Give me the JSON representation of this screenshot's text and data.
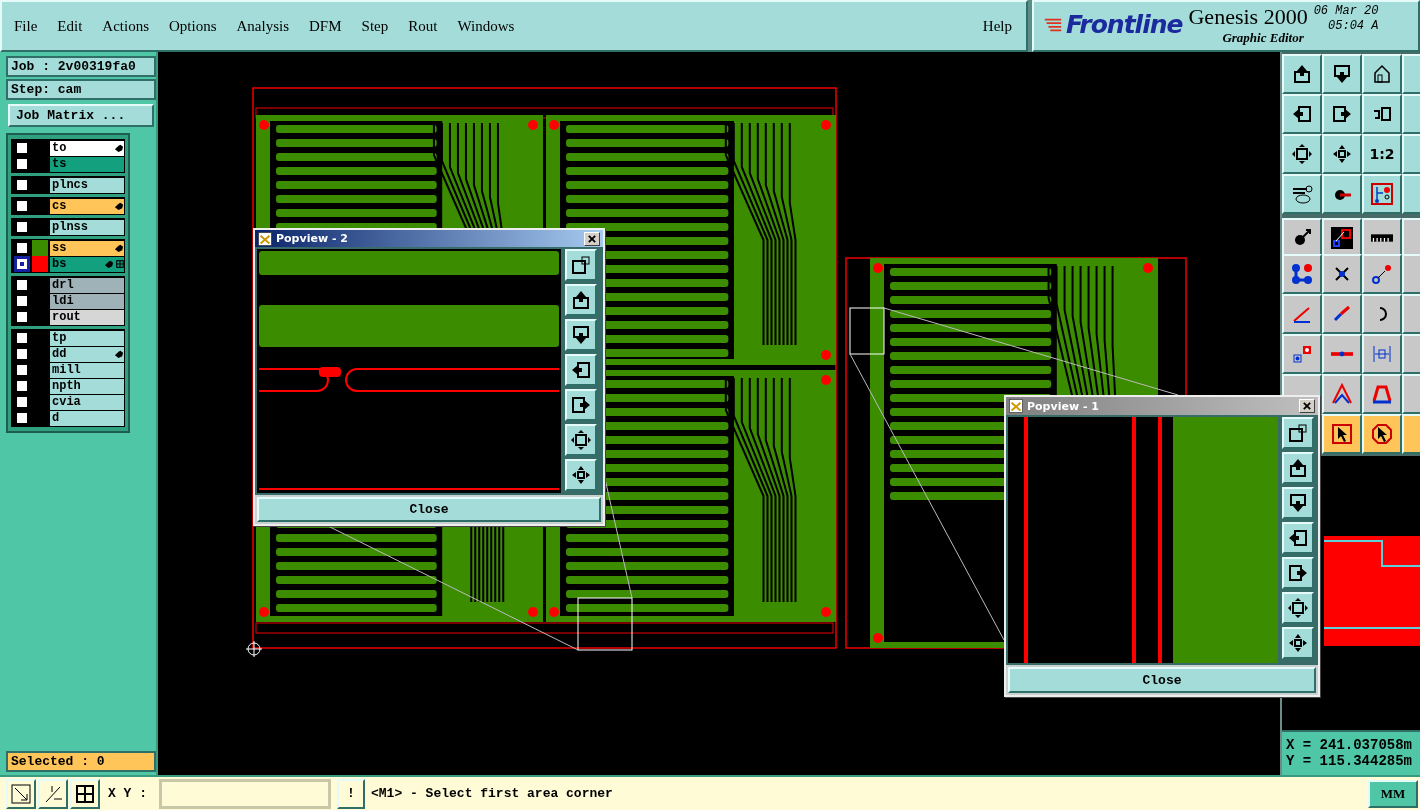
{
  "menu": {
    "items": [
      "File",
      "Edit",
      "Actions",
      "Options",
      "Analysis",
      "DFM",
      "Step",
      "Rout",
      "Windows"
    ],
    "help": "Help"
  },
  "brand": {
    "logo": "Frontline",
    "product": "Genesis 2000",
    "subtitle": "Graphic Editor",
    "date": "06 Mar 20",
    "time": "05:04 A"
  },
  "job": {
    "job": "Job : 2v00319fa0",
    "step": "Step: cam",
    "matrix_button": "Job Matrix ..."
  },
  "layer_groups": [
    [
      {
        "name": "to",
        "kind": "silk",
        "affected": true,
        "selected": false,
        "work": false
      },
      {
        "name": "ts",
        "kind": "mask",
        "affected": false,
        "selected": false,
        "work": false
      }
    ],
    [
      {
        "name": "plncs",
        "kind": "plane",
        "affected": false,
        "selected": false,
        "work": false
      }
    ],
    [
      {
        "name": "cs",
        "kind": "signal",
        "affected": true,
        "selected": false,
        "work": false
      }
    ],
    [
      {
        "name": "plnss",
        "kind": "plane",
        "affected": false,
        "selected": false,
        "work": false
      }
    ],
    [
      {
        "name": "ss",
        "kind": "signal",
        "color": "#3c8c00",
        "affected": true,
        "selected": false,
        "work": false
      },
      {
        "name": "bs",
        "kind": "mask",
        "color": "#ff0000",
        "affected": true,
        "selected": true,
        "work": true
      }
    ],
    [
      {
        "name": "drl",
        "kind": "drill",
        "affected": false,
        "selected": false,
        "work": false
      },
      {
        "name": "ldi",
        "kind": "drill",
        "affected": false,
        "selected": false,
        "work": false
      },
      {
        "name": "rout",
        "kind": "rout",
        "affected": false,
        "selected": false,
        "work": false
      }
    ],
    [
      {
        "name": "tp",
        "kind": "document",
        "affected": false,
        "selected": false,
        "work": false
      },
      {
        "name": "dd",
        "kind": "document",
        "affected": true,
        "selected": false,
        "work": false
      },
      {
        "name": "mill",
        "kind": "document",
        "affected": false,
        "selected": false,
        "work": false
      },
      {
        "name": "npth",
        "kind": "document",
        "affected": false,
        "selected": false,
        "work": false
      },
      {
        "name": "cvia",
        "kind": "document",
        "affected": false,
        "selected": false,
        "work": false
      },
      {
        "name": "d",
        "kind": "document",
        "affected": false,
        "selected": false,
        "work": false
      }
    ]
  ],
  "selected_count": "Selected : 0",
  "toolbar": {
    "ratio_label": "1:2"
  },
  "popviews": [
    {
      "title": "Popview - 2",
      "close": "Close",
      "active": true
    },
    {
      "title": "Popview - 1",
      "close": "Close",
      "active": false
    }
  ],
  "coordinates": {
    "x": "X = 241.037058m",
    "y": "Y = 115.344285m"
  },
  "status": {
    "xy_label": "X Y :",
    "alert_button": "!",
    "prompt": "<M1> - Select first area corner",
    "units": "MM"
  }
}
